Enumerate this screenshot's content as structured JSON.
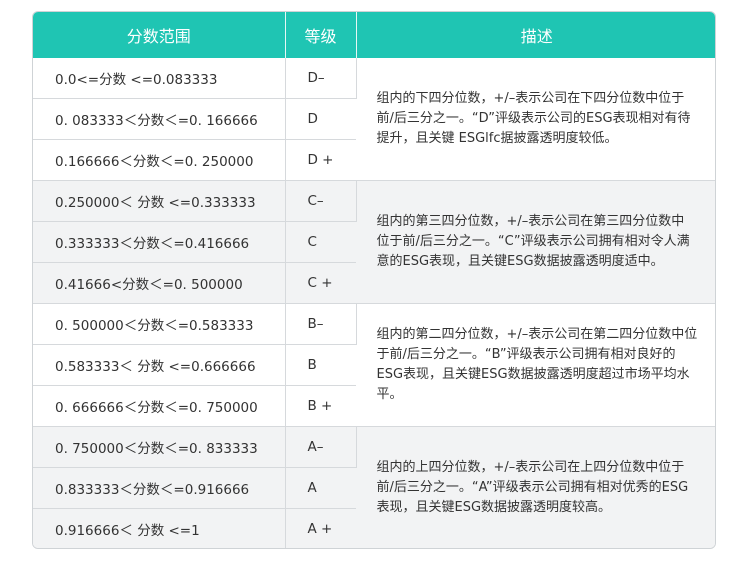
{
  "headers": {
    "range": "分数范围",
    "grade": "等级",
    "description": "描述"
  },
  "groups": [
    {
      "rows": [
        {
          "range": "0.0<=分数 <=0.083333",
          "grade": "D–"
        },
        {
          "range": "0. 083333＜分数＜=0. 166666",
          "grade": "D"
        },
        {
          "range": "0.166666＜分数＜=0. 250000",
          "grade": "D +"
        }
      ],
      "description": "组内的下四分位数，+/–表示公司在下四分位数中位于 前/后三分之一。“D”评级表示公司的ESG表现相对有待提升，且关键 ESGlfc据披露透明度较低。"
    },
    {
      "rows": [
        {
          "range": "0.250000＜ 分数 <=0.333333",
          "grade": "C–"
        },
        {
          "range": "0.333333＜分数＜=0.416666",
          "grade": "C"
        },
        {
          "range": "0.41666<分数＜=0. 500000",
          "grade": "C +"
        }
      ],
      "description": "组内的第三四分位数，+/–表示公司在第三四分位数中 位于前/后三分之一。“C”评级表示公司拥有相对令人满意的ESG表现，且关键ESG数据披露透明度适中。"
    },
    {
      "rows": [
        {
          "range": "0. 500000＜分数＜=0.583333",
          "grade": "B–"
        },
        {
          "range": "0.583333＜ 分数 <=0.666666",
          "grade": "B"
        },
        {
          "range": "0. 666666＜分数＜=0. 750000",
          "grade": "B +"
        }
      ],
      "description": "组内的第二四分位数，+/–表示公司在第二四分位数中位于前/后三分之一。“B”评级表示公司拥有相对良好的ESG表现，且关键ESG数据披露透明度超过市场平均水平。"
    },
    {
      "rows": [
        {
          "range": "0. 750000＜分数＜=0. 833333",
          "grade": "A–"
        },
        {
          "range": "0.833333＜分数＜=0.916666",
          "grade": "A"
        },
        {
          "range": "0.916666＜ 分数 <=1",
          "grade": "A +"
        }
      ],
      "description": "组内的上四分位数，+/–表示公司在上四分位数中位于 前/后三分之一。“A”评级表示公司拥有相对优秀的ESG表现，且关键ESG数据披露透明度较高。"
    }
  ]
}
